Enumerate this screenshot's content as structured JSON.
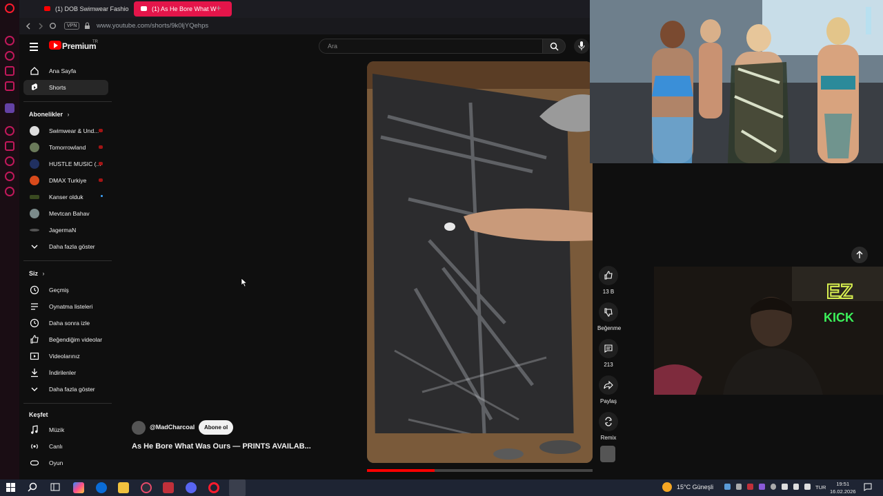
{
  "browser": {
    "tabs": [
      {
        "label": "(1) DOB Swimwear Fashio"
      },
      {
        "label": "(1) As He Bore What W"
      }
    ],
    "new_tab": "+",
    "vpn_badge": "VPN",
    "url": "www.youtube.com/shorts/9k0ljYQehps"
  },
  "yt_header": {
    "brand": "Premium",
    "region": "TR",
    "search_placeholder": "Ara"
  },
  "sidebar": {
    "main_items": [
      {
        "label": "Ana Sayfa",
        "icon": "home-icon"
      },
      {
        "label": "Shorts",
        "icon": "shorts-icon"
      }
    ],
    "subscriptions_header": "Abonelikler",
    "subscriptions": [
      {
        "label": "Swimwear & Und..."
      },
      {
        "label": "Tomorrowland"
      },
      {
        "label": "HUSTLE MUSIC (..."
      },
      {
        "label": "DMAX Turkiye"
      },
      {
        "label": "Kanser olduk"
      },
      {
        "label": "Mevtcan Bahav"
      },
      {
        "label": "JagermaN"
      }
    ],
    "subs_show_more": "Daha fazla göster",
    "you_header": "Siz",
    "you_items": [
      {
        "label": "Geçmiş"
      },
      {
        "label": "Oynatma listeleri"
      },
      {
        "label": "Daha sonra izle"
      },
      {
        "label": "Beğendiğim videolar"
      },
      {
        "label": "Videolarınız"
      },
      {
        "label": "İndirilenler"
      }
    ],
    "you_show_more": "Daha fazla göster",
    "explore_header": "Keşfet",
    "explore_items": [
      {
        "label": "Müzik"
      },
      {
        "label": "Canlı"
      },
      {
        "label": "Oyun"
      }
    ]
  },
  "short": {
    "channel": "@MadCharcoal",
    "subscribe": "Abone ol",
    "title": "As He Bore What Was Ours — PRINTS AVAILAB...",
    "progress": 0.3
  },
  "actions": {
    "likes": "13 B",
    "dislike": "Beğenme",
    "comments": "213",
    "share": "Paylaş",
    "remix": "Remix"
  },
  "webcam_sign": {
    "line1": "EZ",
    "line2": "KICK"
  },
  "taskbar": {
    "weather": "15°C  Güneşli",
    "lang": "TUR",
    "time": "19:51",
    "date": "16.02.2026"
  },
  "colors": {
    "accent": "#e4154a",
    "yt_red": "#ff0000",
    "bg": "#0f0f0f"
  }
}
